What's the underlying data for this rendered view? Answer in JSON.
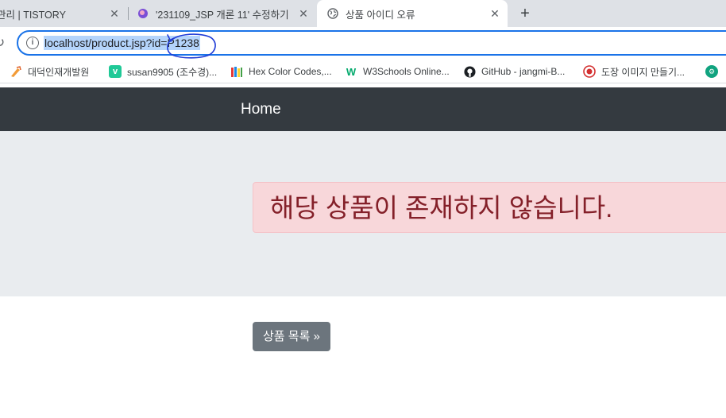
{
  "browser": {
    "tabs": [
      {
        "title": "관리 | TISTORY"
      },
      {
        "title": "'231109_JSP 개론 11' 수정하기"
      },
      {
        "title": "상품 아이디 오류"
      }
    ],
    "new_tab_icon": "plus-icon",
    "url": "localhost/product.jsp?id=P1238",
    "bookmarks": [
      {
        "label": "대덕인재개발원",
        "icon": "tools-icon"
      },
      {
        "label": "susan9905 (조수경)...",
        "icon": "velog-icon"
      },
      {
        "label": "Hex Color Codes,...",
        "icon": "books-icon"
      },
      {
        "label": "W3Schools Online...",
        "icon": "w3schools-icon"
      },
      {
        "label": "GitHub - jangmi-B...",
        "icon": "github-icon"
      },
      {
        "label": "도장 이미지 만들기...",
        "icon": "stamp-icon"
      }
    ]
  },
  "page": {
    "navbar": {
      "brand": "Home"
    },
    "alert": {
      "message": "해당 상품이 존재하지 않습니다."
    },
    "list_button": {
      "label": "상품 목록 »"
    }
  },
  "colors": {
    "navbar_bg": "#343a40",
    "jumbotron_bg": "#e9ecef",
    "alert_bg": "#f8d7da",
    "alert_text": "#842029",
    "button_bg": "#6c757d",
    "omnibox_border": "#1a73e8"
  }
}
